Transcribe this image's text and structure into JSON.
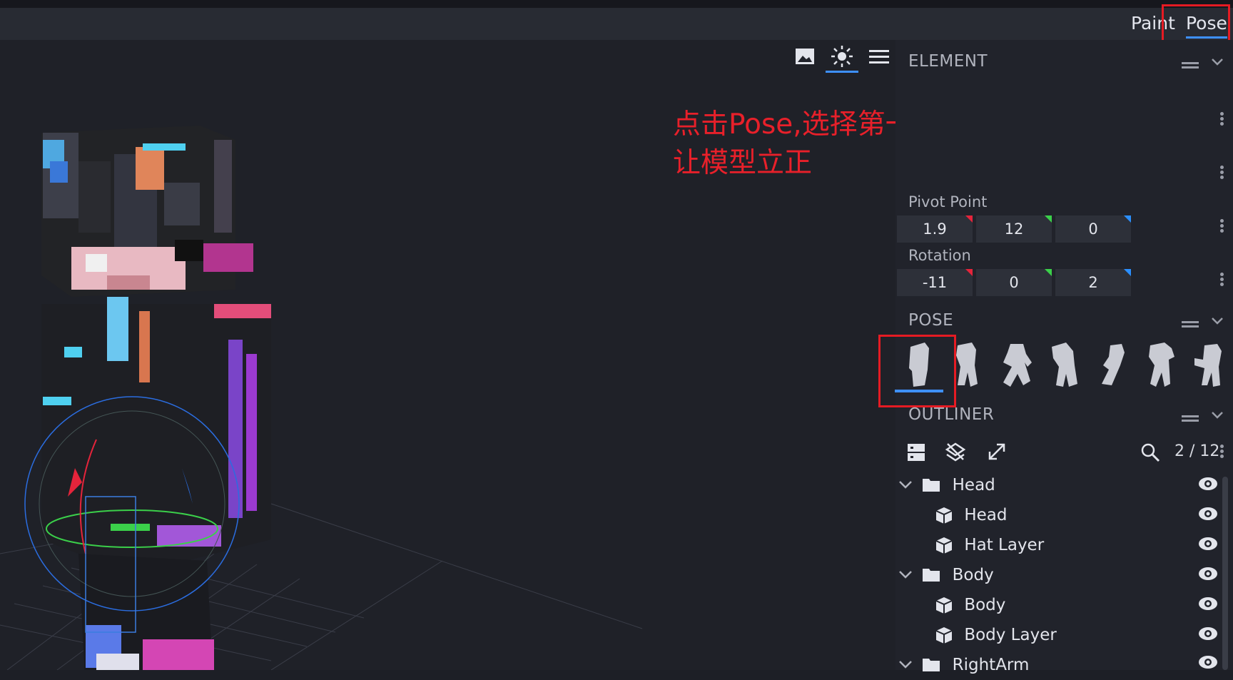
{
  "header": {
    "tabs": [
      {
        "label": "Paint",
        "active": false
      },
      {
        "label": "Pose",
        "active": true
      }
    ]
  },
  "viewport": {
    "tools": [
      {
        "icon": "image-icon",
        "active": false
      },
      {
        "icon": "sun-icon",
        "active": true
      },
      {
        "icon": "menu-icon",
        "active": false
      }
    ]
  },
  "annotation": {
    "text": "点击Pose,选择第一个动作\n让模型立正",
    "color": "#e8202a"
  },
  "element_panel": {
    "title": "ELEMENT",
    "pivot_label": "Pivot Point",
    "pivot": [
      "1.9",
      "12",
      "0"
    ],
    "rotation_label": "Rotation",
    "rotation": [
      "-11",
      "0",
      "2"
    ]
  },
  "pose_panel": {
    "title": "POSE",
    "poses": [
      "pose-standing-icon",
      "pose-walk-icon",
      "pose-run-icon",
      "pose-crouch-icon",
      "pose-wave-icon",
      "pose-point-icon",
      "pose-reach-icon"
    ],
    "selected_index": 0
  },
  "outliner": {
    "title": "OUTLINER",
    "count": "2 / 12",
    "items": [
      {
        "label": "Head",
        "type": "folder"
      },
      {
        "label": "Head",
        "type": "cube"
      },
      {
        "label": "Hat Layer",
        "type": "cube"
      },
      {
        "label": "Body",
        "type": "folder"
      },
      {
        "label": "Body",
        "type": "cube"
      },
      {
        "label": "Body Layer",
        "type": "cube"
      },
      {
        "label": "RightArm",
        "type": "folder"
      }
    ]
  },
  "colors": {
    "accent": "#3e90ff",
    "annotation_red": "#e51b23",
    "axis_x": "#e5243b",
    "axis_y": "#3bd04a",
    "axis_z": "#2b8fff"
  }
}
